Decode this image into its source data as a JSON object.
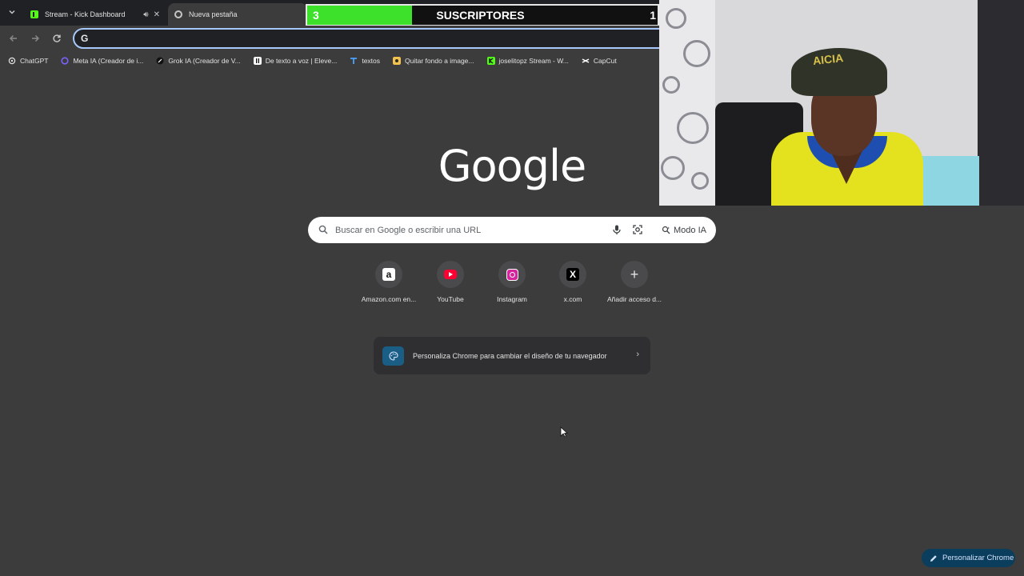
{
  "browser": {
    "tabs": [
      {
        "title": "Stream - Kick Dashboard",
        "favicon": "kick-icon",
        "active": false
      },
      {
        "title": "Nueva pestaña",
        "favicon": "chrome-icon",
        "active": true
      }
    ],
    "omnibox": {
      "value": "",
      "placeholder": "",
      "engine_icon": "G"
    },
    "bookmarks": [
      {
        "label": "ChatGPT",
        "icon": "chatgpt-icon",
        "color": "#e3e3e3"
      },
      {
        "label": "Meta IA (Creador de i...",
        "icon": "meta-ai-icon",
        "color": "#7b61ff"
      },
      {
        "label": "Grok IA (Creador de V...",
        "icon": "grok-icon",
        "color": "#111111"
      },
      {
        "label": "De texto a voz | Eleve...",
        "icon": "elevenlabs-icon",
        "color": "#ffffff"
      },
      {
        "label": "textos",
        "icon": "textos-icon",
        "color": "#4aa3ff"
      },
      {
        "label": "Quitar fondo a image...",
        "icon": "removebg-icon",
        "color": "#f2c14e"
      },
      {
        "label": "joselitopz Stream - W...",
        "icon": "kick-icon",
        "color": "#53fc18"
      },
      {
        "label": "CapCut",
        "icon": "capcut-icon",
        "color": "#ffffff"
      }
    ]
  },
  "overlay": {
    "subscribers": {
      "count": "3",
      "label": "SUSCRIPTORES",
      "goal": "1",
      "progress": 0.3,
      "bar_color": "#3de02a"
    },
    "webcam": {
      "cap_text": "AICIA"
    }
  },
  "ntp": {
    "logo": "Google",
    "search": {
      "placeholder": "Buscar en Google o escribir una URL",
      "ai_mode_label": "Modo IA"
    },
    "shortcuts": [
      {
        "label": "Amazon.com en...",
        "icon": "amazon-icon"
      },
      {
        "label": "YouTube",
        "icon": "youtube-icon"
      },
      {
        "label": "Instagram",
        "icon": "instagram-icon"
      },
      {
        "label": "x.com",
        "icon": "x-icon"
      },
      {
        "label": "Añadir acceso d...",
        "icon": "plus-icon"
      }
    ],
    "customize_card": {
      "text": "Personaliza Chrome para cambiar el diseño de tu navegador"
    },
    "customize_button": {
      "label": "Personalizar Chrome"
    }
  },
  "colors": {
    "background": "#3c3c3c",
    "accent": "#a8c7fa",
    "button_bg": "#0b3d5c"
  }
}
